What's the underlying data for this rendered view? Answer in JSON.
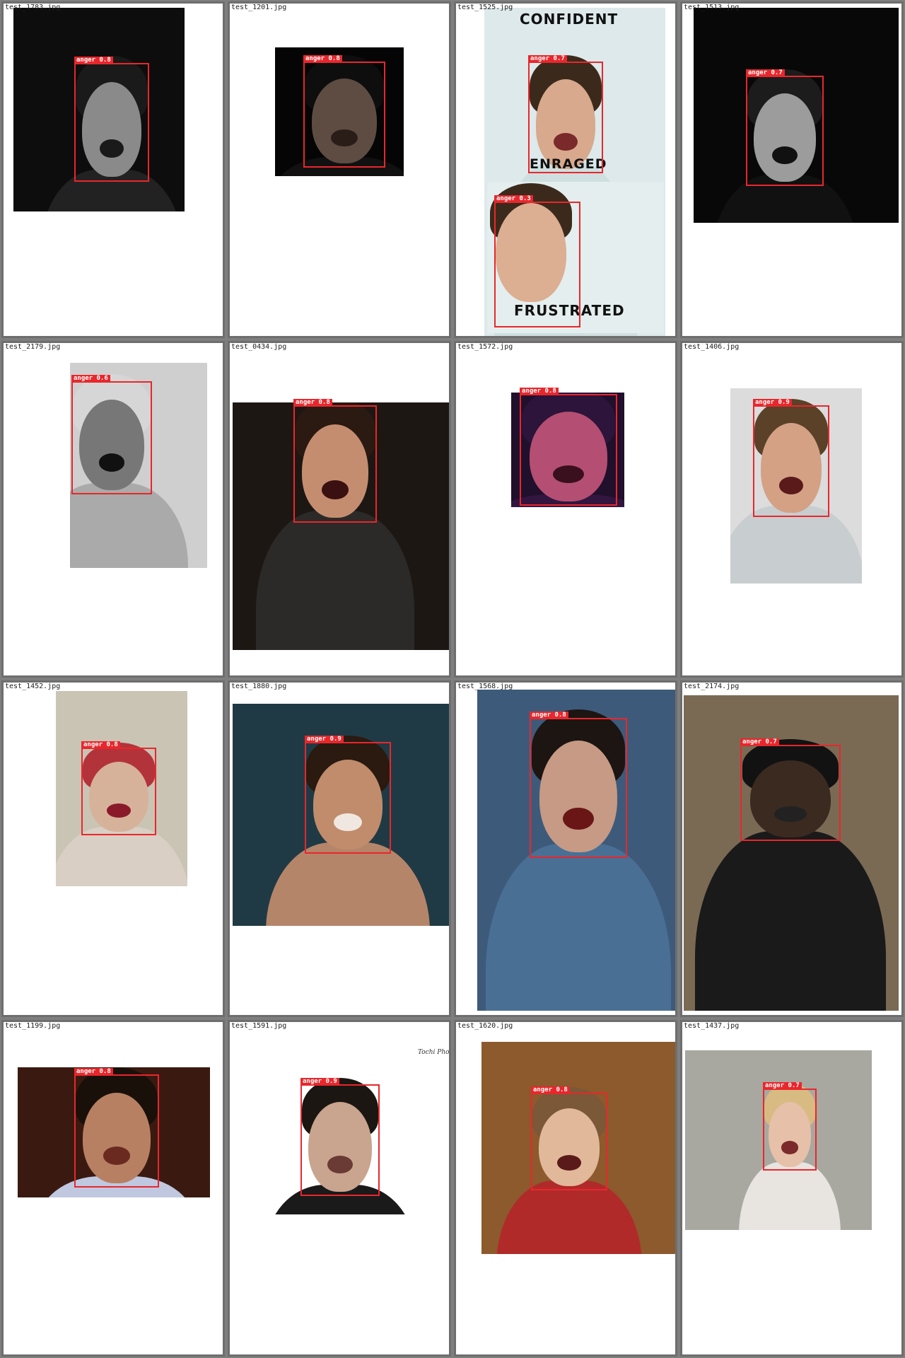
{
  "label": "anger",
  "cells": [
    {
      "file": "test_1783.jpg",
      "score": "0.8"
    },
    {
      "file": "test_1201.jpg",
      "score": "0.8"
    },
    {
      "file": "test_1525.jpg",
      "score": "0.7",
      "extra_score": "0.3",
      "texts": [
        "CONFIDENT",
        "ENRAGED",
        "FRUSTRATED"
      ]
    },
    {
      "file": "test_1513.jpg",
      "score": "0.7"
    },
    {
      "file": "test_2179.jpg",
      "score": "0.6"
    },
    {
      "file": "test_0434.jpg",
      "score": "0.8"
    },
    {
      "file": "test_1572.jpg",
      "score": "0.8"
    },
    {
      "file": "test_1406.jpg",
      "score": "0.9"
    },
    {
      "file": "test_1452.jpg",
      "score": "0.8"
    },
    {
      "file": "test_1880.jpg",
      "score": "0.9"
    },
    {
      "file": "test_1568.jpg",
      "score": "0.8"
    },
    {
      "file": "test_2174.jpg",
      "score": "0.7"
    },
    {
      "file": "test_1199.jpg",
      "score": "0.8"
    },
    {
      "file": "test_1591.jpg",
      "score": "0.9",
      "signature": "Tochi Pho"
    },
    {
      "file": "test_1620.jpg",
      "score": "0.8"
    },
    {
      "file": "test_1437.jpg",
      "score": "0.7"
    }
  ]
}
